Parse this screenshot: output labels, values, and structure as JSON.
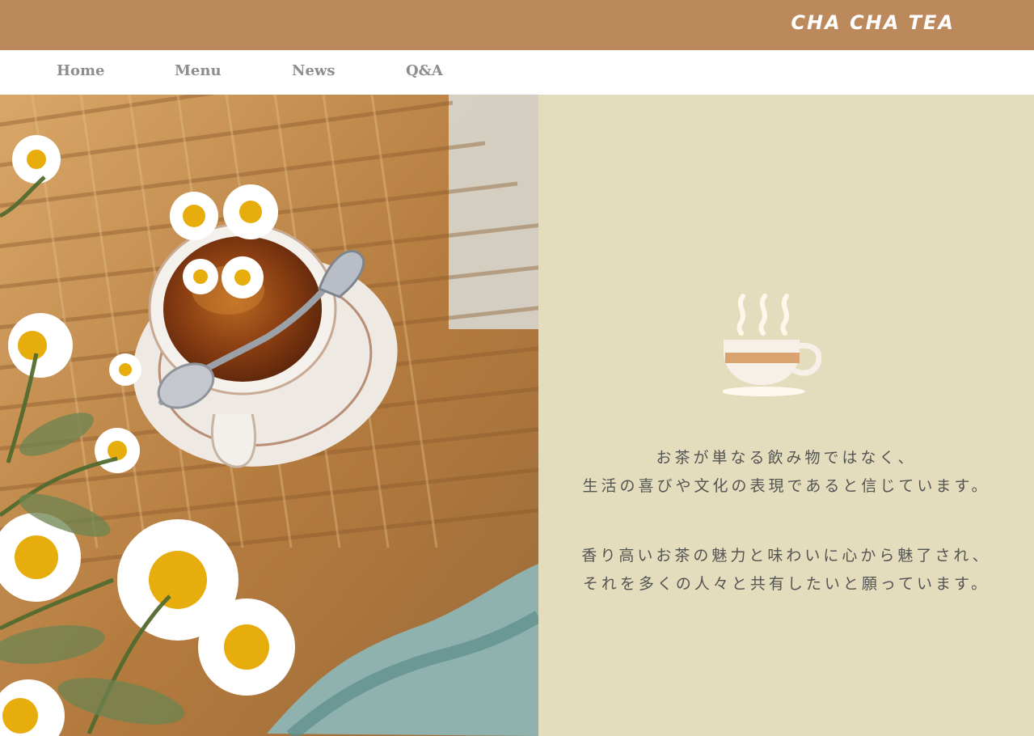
{
  "brand": "CHA CHA TEA",
  "nav": {
    "items": [
      "Home",
      "Menu",
      "News",
      "Q&A"
    ]
  },
  "hero": {
    "image_label": ""
  },
  "intro": {
    "line1": "お茶が単なる飲み物ではなく、",
    "line2": "生活の喜びや文化の表現であると信じています。",
    "line3": "香り高いお茶の魅力と味わいに心から魅了され、",
    "line4": "それを多くの人々と共有したいと願っています。"
  },
  "colors": {
    "header": "#bc895c",
    "panel": "#e4ddbd",
    "nav_text": "#8d8d8d"
  },
  "icons": {
    "tea_cup": "tea-cup-icon"
  }
}
